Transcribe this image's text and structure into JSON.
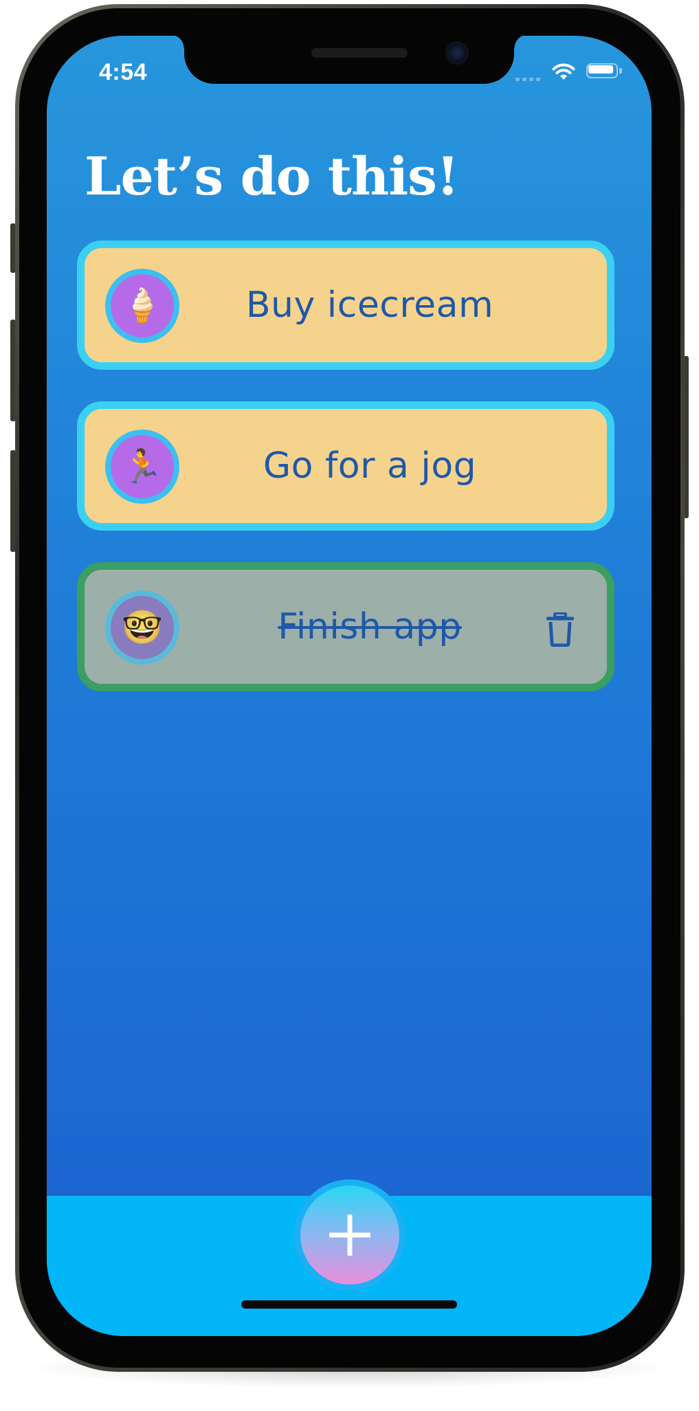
{
  "status_bar": {
    "time": "4:54",
    "icons": [
      "cellular-signal-icon",
      "wifi-icon",
      "battery-icon"
    ]
  },
  "header": {
    "title": "Let’s do this!"
  },
  "tasks": [
    {
      "emoji": "🍦",
      "label": "Buy icecream",
      "completed": false
    },
    {
      "emoji": "🏃",
      "label": "Go for a jog",
      "completed": false
    },
    {
      "emoji": "🤓",
      "label": "Finish app",
      "completed": true,
      "action_icon": "trash-icon"
    }
  ],
  "toolbar": {
    "add_icon": "plus-icon"
  },
  "colors": {
    "background_top": "#2796dc",
    "background_bottom": "#1b61cf",
    "card_fill": "#f6d38d",
    "card_border": "#3bd0f2",
    "completed_fill": "#9dafa9",
    "completed_border": "#3b9e62",
    "emoji_badge": "#b56be8",
    "task_text": "#1f58a8",
    "bottom_bar": "#02b5f6"
  }
}
